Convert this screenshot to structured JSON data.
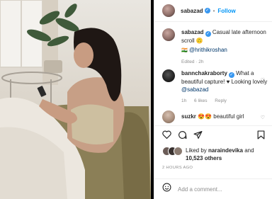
{
  "post": {
    "author": "sabazad",
    "follow_label": "Follow",
    "caption_text": "Casual late afternoon scroll 🙃",
    "tag_user": "@hrithikroshan",
    "edited_label": "Edited · 2h"
  },
  "comments": [
    {
      "user": "bannchakraborty",
      "text": "What a beautiful capture! ♥ Looking lovely",
      "mention": "@sabazad",
      "time": "1h",
      "likes": "6 likes",
      "reply": "Reply"
    },
    {
      "user": "suzkr",
      "text": "😍😍 beautiful girl"
    }
  ],
  "likes": {
    "prefix": "Liked by",
    "user": "naraindevika",
    "joiner": "and",
    "others": "10,523 others"
  },
  "timestamp": "2 HOURS AGO",
  "add_comment": {
    "placeholder": "Add a comment..."
  },
  "icons": [
    "heart-icon",
    "comment-icon",
    "share-icon",
    "bookmark-icon",
    "emoji-icon",
    "verified-badge-icon"
  ],
  "colors": {
    "accent": "#0095f6",
    "verified": "#3897f0",
    "text": "#262626",
    "muted": "#8e8e8e"
  }
}
